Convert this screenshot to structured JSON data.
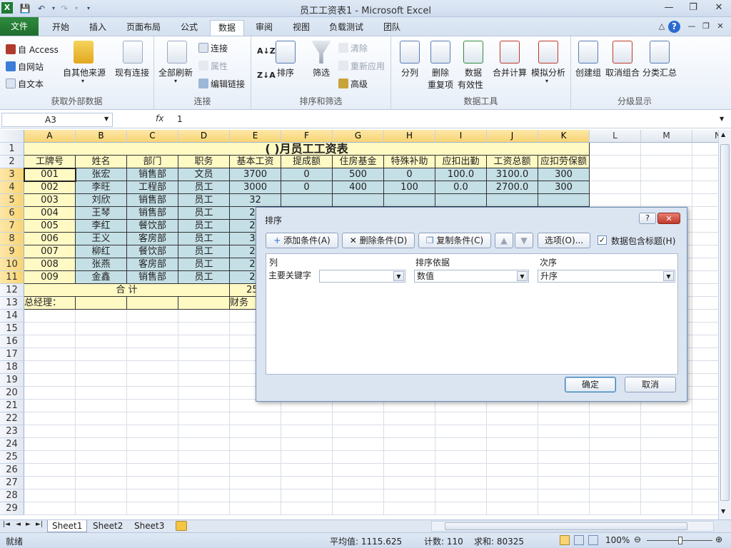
{
  "window": {
    "title": "员工工资表1 - Microsoft Excel"
  },
  "tabs": [
    "文件",
    "开始",
    "插入",
    "页面布局",
    "公式",
    "数据",
    "审阅",
    "视图",
    "负载测试",
    "团队"
  ],
  "ribbon": {
    "get_external": {
      "access": "自 Access",
      "web": "自网站",
      "text": "自文本",
      "other": "自其他来源",
      "existing": "现有连接",
      "label": "获取外部数据"
    },
    "connections": {
      "refresh_all": "全部刷新",
      "connect": "连接",
      "properties": "属性",
      "edit_links": "编辑链接",
      "label": "连接"
    },
    "sort_filter": {
      "sort": "排序",
      "filter": "筛选",
      "clear": "清除",
      "reapply": "重新应用",
      "advanced": "高级",
      "label": "排序和筛选"
    },
    "data_tools": {
      "split": "分列",
      "remove_dup_1": "删除",
      "remove_dup_2": "重复项",
      "validation_1": "数据",
      "validation_2": "有效性",
      "consolidate": "合并计算",
      "whatif": "模拟分析",
      "label": "数据工具"
    },
    "outline": {
      "group": "创建组",
      "ungroup": "取消组合",
      "subtotal": "分类汇总",
      "label": "分级显示"
    }
  },
  "formula_bar": {
    "name_box": "A3",
    "fx": "fx",
    "value": "1"
  },
  "columns": [
    "A",
    "B",
    "C",
    "D",
    "E",
    "F",
    "G",
    "H",
    "I",
    "J",
    "K",
    "L",
    "M",
    "N"
  ],
  "rows": [
    "1",
    "2",
    "3",
    "4",
    "5",
    "6",
    "7",
    "8",
    "9",
    "10",
    "11",
    "12",
    "13",
    "14",
    "15",
    "16",
    "17",
    "18",
    "19",
    "20",
    "21",
    "22",
    "23",
    "24",
    "25",
    "26",
    "27",
    "28",
    "29"
  ],
  "sheet": {
    "title": "(  )月员工工资表",
    "headers": [
      "工牌号",
      "姓名",
      "部门",
      "职务",
      "基本工资",
      "提成额",
      "住房基金",
      "特殊补助",
      "应扣出勤",
      "工资总额",
      "应扣劳保额"
    ],
    "data": [
      [
        "001",
        "张宏",
        "销售部",
        "文员",
        "3700",
        "0",
        "500",
        "0",
        "100.0",
        "3100.0",
        "300"
      ],
      [
        "002",
        "李旺",
        "工程部",
        "员工",
        "3000",
        "0",
        "400",
        "100",
        "0.0",
        "2700.0",
        "300"
      ],
      [
        "003",
        "刘欣",
        "销售部",
        "员工",
        "32",
        "",
        "",
        "",
        "",
        "",
        ""
      ],
      [
        "004",
        "王琴",
        "销售部",
        "员工",
        "25",
        "",
        "",
        "",
        "",
        "",
        ""
      ],
      [
        "005",
        "李红",
        "餐饮部",
        "员工",
        "28",
        "",
        "",
        "",
        "",
        "",
        ""
      ],
      [
        "006",
        "王义",
        "客房部",
        "员工",
        "34",
        "",
        "",
        "",
        "",
        "",
        ""
      ],
      [
        "007",
        "柳红",
        "餐饮部",
        "员工",
        "23",
        "",
        "",
        "",
        "",
        "",
        ""
      ],
      [
        "008",
        "张燕",
        "客房部",
        "员工",
        "21",
        "",
        "",
        "",
        "",
        "",
        ""
      ],
      [
        "009",
        "金鑫",
        "销售部",
        "员工",
        "23",
        "",
        "",
        "",
        "",
        "",
        ""
      ]
    ],
    "total_label": "合  计",
    "total_value": "254",
    "manager_label": "总经理：",
    "finance_label": "财务"
  },
  "sheet_tabs": [
    "Sheet1",
    "Sheet2",
    "Sheet3"
  ],
  "status": {
    "ready": "就绪",
    "average": "平均值: 1115.625",
    "count": "计数: 110",
    "sum": "求和: 80325",
    "zoom": "100%"
  },
  "dialog": {
    "title": "排序",
    "add": "添加条件(A)",
    "delete": "删除条件(D)",
    "copy": "复制条件(C)",
    "options": "选项(O)...",
    "has_header": "数据包含标题(H)",
    "col_header": "列",
    "basis_header": "排序依据",
    "order_header": "次序",
    "primary_key": "主要关键字",
    "basis_value": "数值",
    "order_value": "升序",
    "ok": "确定",
    "cancel": "取消"
  }
}
